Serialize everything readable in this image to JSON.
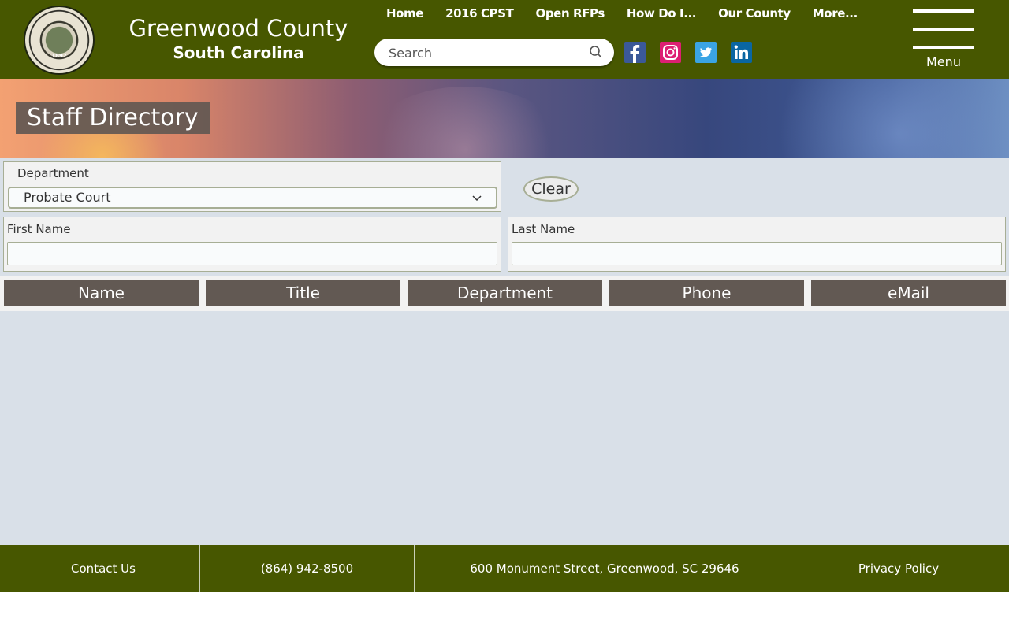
{
  "header": {
    "seal_year": "1897",
    "site_title": "Greenwood County",
    "site_subtitle": "South Carolina",
    "nav": [
      "Home",
      "2016 CPST",
      "Open RFPs",
      "How Do I...",
      "Our County",
      "More..."
    ],
    "search_placeholder": "Search",
    "social": [
      "facebook-icon",
      "instagram-icon",
      "twitter-icon",
      "linkedin-icon"
    ],
    "menu_label": "Menu"
  },
  "banner": {
    "title": "Staff Directory"
  },
  "filters": {
    "department_label": "Department",
    "department_value": "Probate Court",
    "clear_label": "Clear",
    "first_name_label": "First Name",
    "last_name_label": "Last Name"
  },
  "table": {
    "columns": [
      "Name",
      "Title",
      "Department",
      "Phone",
      "eMail"
    ]
  },
  "footer": {
    "contact": "Contact Us",
    "phone": "(864) 942-8500",
    "address": "600 Monument Street, Greenwood, SC 29646",
    "privacy": "Privacy Policy"
  },
  "colors": {
    "brand_green": "#475700",
    "header_cell": "#625953",
    "main_bg": "#d9e0e8"
  }
}
